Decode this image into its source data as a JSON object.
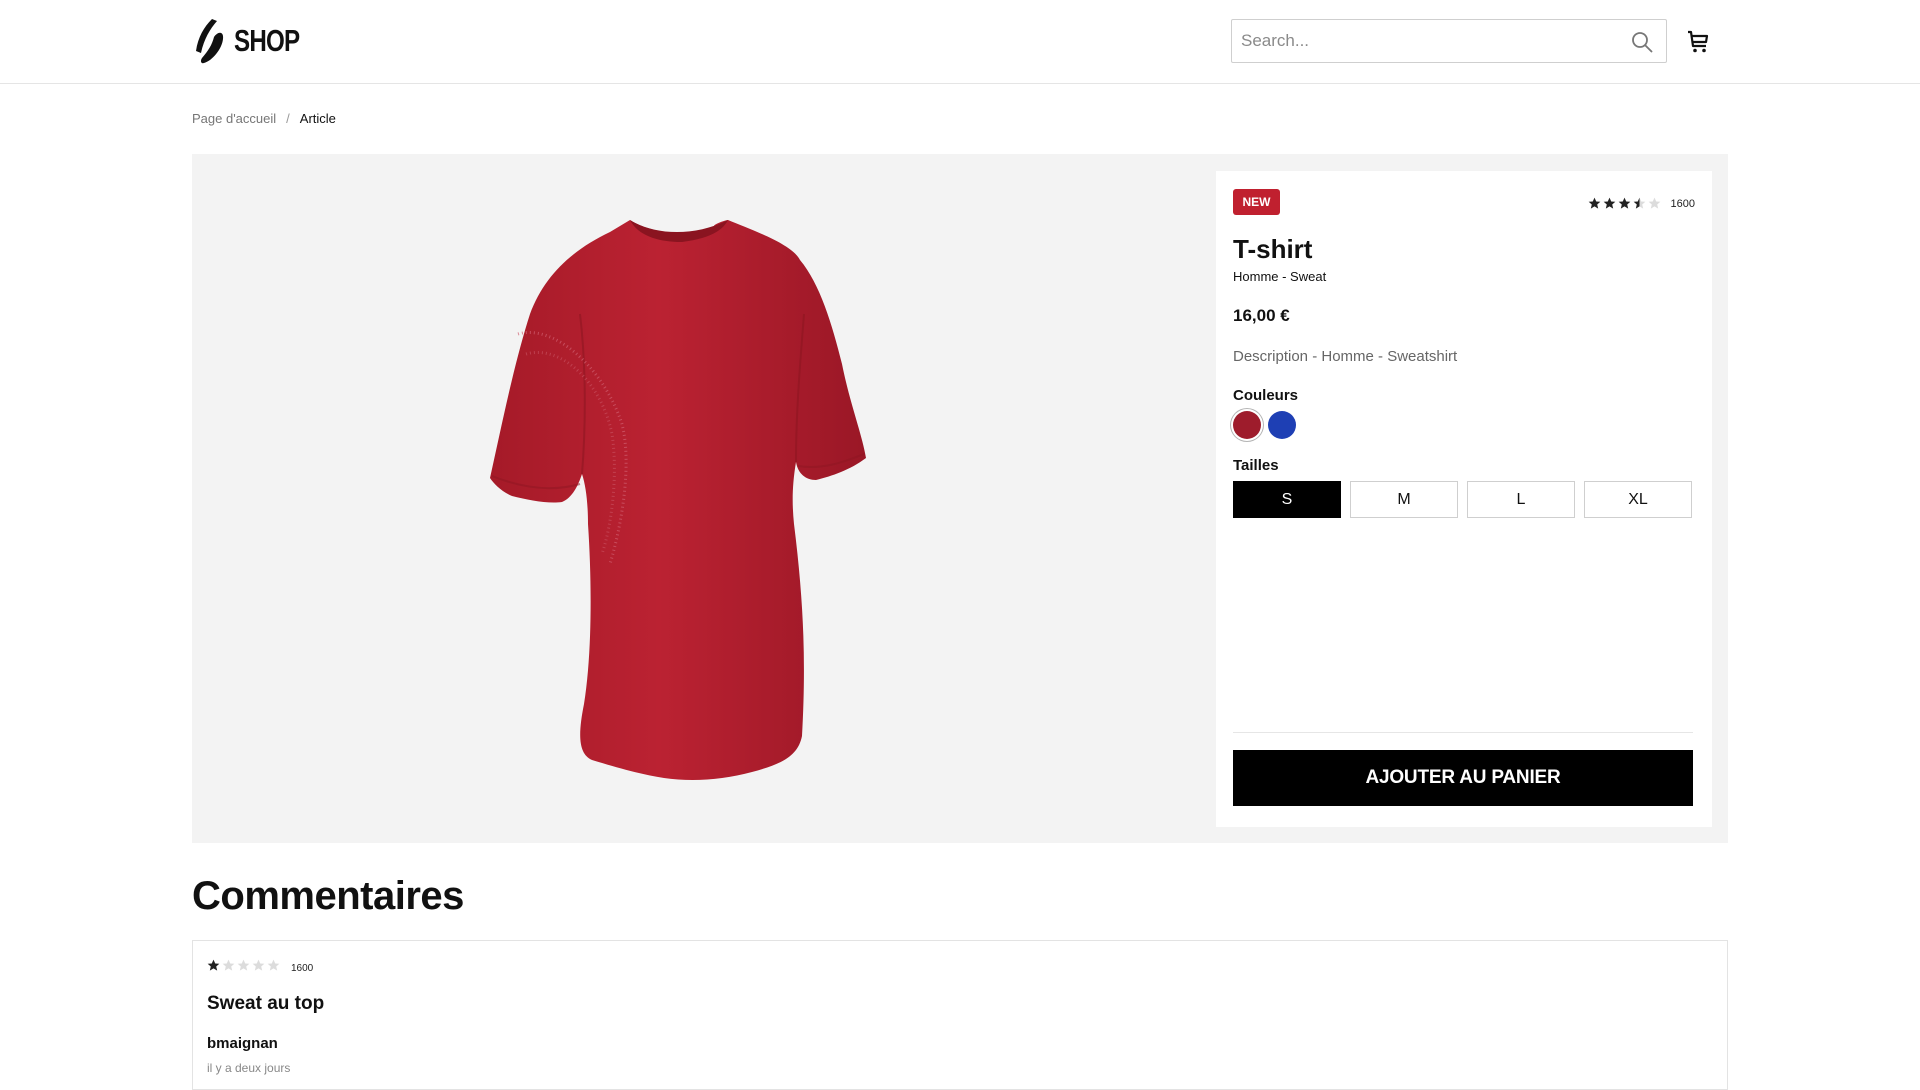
{
  "header": {
    "logo_text": "SHOP",
    "search_placeholder": "Search..."
  },
  "breadcrumb": {
    "items": [
      "Page d'accueil",
      "Article"
    ],
    "separator": "/"
  },
  "product": {
    "badge": "NEW",
    "rating_value": 3.5,
    "rating_max": 5,
    "rating_count": "1600",
    "title": "T-shirt",
    "category": "Homme - Sweat",
    "price": "16,00 €",
    "description": "Description - Homme - Sweatshirt",
    "colors_label": "Couleurs",
    "colors": [
      "#9e1c2c",
      "#1e3fb4"
    ],
    "selected_color_index": 0,
    "sizes_label": "Tailles",
    "sizes": [
      "S",
      "M",
      "L",
      "XL"
    ],
    "selected_size": "S",
    "add_to_cart_label": "AJOUTER AU PANIER",
    "image_color": "#b8202f"
  },
  "comments": {
    "title": "Commentaires",
    "items": [
      {
        "rating_value": 1,
        "rating_max": 5,
        "rating_count": "1600",
        "title": "Sweat au top",
        "author": "bmaignan",
        "date": "il y a deux jours"
      }
    ]
  },
  "icons": {
    "search": "search-icon",
    "cart": "cart-icon",
    "star": "star-icon"
  }
}
